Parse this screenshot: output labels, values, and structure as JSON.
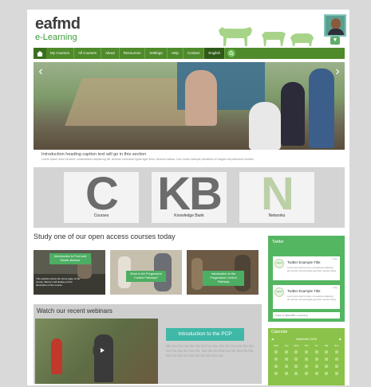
{
  "brand": {
    "logo_name": "eafmd",
    "logo_subtitle": "e-Learning"
  },
  "nav": {
    "items": [
      "My Courses",
      "All Courses",
      "About",
      "Resources",
      "Settings",
      "Help",
      "Contact"
    ],
    "language": "English"
  },
  "hero": {
    "caption_title": "Introduction heading caption text will go in this section",
    "caption_body": "Lorem ipsum dolor sit amet, consectetuer adipiscing elit. Aenean commodo ligula eget dolor. Aenean massa. Cum sociis natoque penatibus et magnis dis parturient montes."
  },
  "tiles": [
    {
      "letter": "C",
      "label": "Courses"
    },
    {
      "letter": "KB",
      "label": "Knowledge Bank"
    },
    {
      "letter": "N",
      "label": "Networks"
    }
  ],
  "study": {
    "heading": "Study one of our open access courses today",
    "courses": [
      {
        "title": "Introduction to Foot and Mouth disease",
        "description": "This website shows the home page of the course. Below it will display a brief description of the course."
      },
      {
        "title": "What is the Progressive Control Pathway?"
      },
      {
        "title": "Introduction to the Progressive Control Pathway"
      }
    ]
  },
  "webinars": {
    "heading": "Watch our recent webinars",
    "title": "Introduction to the PCP",
    "description": "Bla bla bla bla bla bla bla bla bla. Bla bla bla bla bla bla bla bla bla bla bla bla. Bla bla bla bla bla bla bla bla bla bla bla bla bla bla bla bla bla bla bla."
  },
  "twitter": {
    "heading": "Twitter",
    "tweets": [
      {
        "avatar_text": "eafmd",
        "title": "Twitter Example Title",
        "date": "1 May",
        "body": "Lorem ipsum dolor sit amet, consectetuer adipiscing elit. Aenean commodo ligula eget dolor. Aenean massa."
      },
      {
        "avatar_text": "eafmd",
        "title": "Twitter Example Title",
        "date": "1 May",
        "body": "Lorem ipsum dolor sit amet, consectetuer adipiscing elit. Aenean commodo ligula eget dolor. Aenean massa."
      }
    ],
    "follow": "Tweet to @EuFMD e-Learning"
  },
  "calendar": {
    "heading": "Calendar",
    "prev": "◀",
    "month": "September 2016",
    "next": "▶",
    "weekdays": [
      "Mon",
      "Tue",
      "Wed",
      "Thu",
      "Fri",
      "Sat",
      "Sun"
    ]
  },
  "colors": {
    "brand_green": "#4f8a2b",
    "accent_green": "#55b661",
    "teal": "#40b8a8"
  }
}
